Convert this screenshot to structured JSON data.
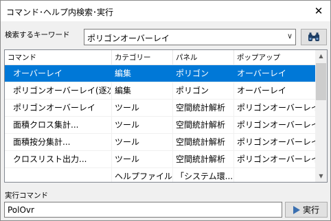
{
  "window": {
    "title": "コマンド･ヘルプ内検索･実行",
    "close_glyph": "✕"
  },
  "search": {
    "keyword_label": "検索するキーワード",
    "keyword_value": "ポリゴンオーバーレイ",
    "dropdown_glyph": "∨",
    "search_icon": "binoculars-icon"
  },
  "table": {
    "columns": [
      "コマンド",
      "カテゴリー",
      "パネル",
      "ポップアップ"
    ],
    "rows": [
      [
        "オーバーレイ",
        "編集",
        "ポリゴン",
        "オーバーレイ"
      ],
      [
        "ポリゴンオーバーレイ(逐次...",
        "編集",
        "ポリゴン",
        "オーバーレイ"
      ],
      [
        "ポリゴンオーバーレイ",
        "ツール",
        "空間統計解析",
        "ポリゴンオーバーレイ"
      ],
      [
        "面積クロス集計...",
        "ツール",
        "空間統計解析",
        "ポリゴンオーバーレイ"
      ],
      [
        "面積按分集計...",
        "ツール",
        "空間統計解析",
        "ポリゴンオーバーレイ"
      ],
      [
        "クロスリスト出力...",
        "ツール",
        "空間統計解析",
        "ポリゴンオーバーレイ"
      ],
      [
        "",
        "ヘルプファイル",
        "「システム環...",
        ""
      ]
    ],
    "selected_row_index": 0,
    "selection_color": "#0078d7"
  },
  "execute": {
    "label": "実行コマンド",
    "command_value": "PolOvr",
    "run_label": "実行",
    "run_icon": "play-icon"
  }
}
